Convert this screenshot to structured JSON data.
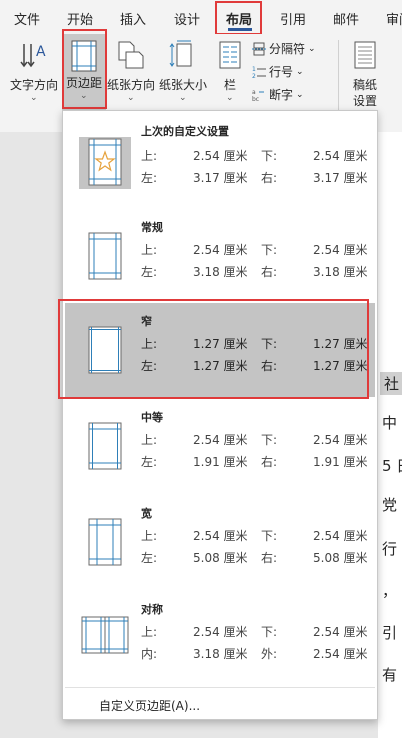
{
  "tabs": [
    {
      "label": "文件"
    },
    {
      "label": "开始"
    },
    {
      "label": "插入"
    },
    {
      "label": "设计"
    },
    {
      "label": "布局"
    },
    {
      "label": "引用"
    },
    {
      "label": "邮件"
    },
    {
      "label": "审阅"
    }
  ],
  "active_tab": "布局",
  "ribbon": {
    "text_direction": "文字方向",
    "margins": "页边距",
    "orientation": "纸张方向",
    "size": "纸张大小",
    "columns": "栏",
    "breaks": "分隔符",
    "line_numbers": "行号",
    "hyphenation": "断字",
    "draft_paper_line1": "稿纸",
    "draft_paper_line2": "设置"
  },
  "margins_menu": {
    "options": [
      {
        "name": "上次的自定义设置",
        "top_label": "上:",
        "top": "2.54 厘米",
        "bottom_label": "下:",
        "bottom": "2.54 厘米",
        "left_label": "左:",
        "left": "3.17 厘米",
        "right_label": "右:",
        "right": "3.17 厘米"
      },
      {
        "name": "常规",
        "top_label": "上:",
        "top": "2.54 厘米",
        "bottom_label": "下:",
        "bottom": "2.54 厘米",
        "left_label": "左:",
        "left": "3.18 厘米",
        "right_label": "右:",
        "right": "3.18 厘米"
      },
      {
        "name": "窄",
        "top_label": "上:",
        "top": "1.27 厘米",
        "bottom_label": "下:",
        "bottom": "1.27 厘米",
        "left_label": "左:",
        "left": "1.27 厘米",
        "right_label": "右:",
        "right": "1.27 厘米"
      },
      {
        "name": "中等",
        "top_label": "上:",
        "top": "2.54 厘米",
        "bottom_label": "下:",
        "bottom": "2.54 厘米",
        "left_label": "左:",
        "left": "1.91 厘米",
        "right_label": "右:",
        "right": "1.91 厘米"
      },
      {
        "name": "宽",
        "top_label": "上:",
        "top": "2.54 厘米",
        "bottom_label": "下:",
        "bottom": "2.54 厘米",
        "left_label": "左:",
        "left": "5.08 厘米",
        "right_label": "右:",
        "right": "5.08 厘米"
      },
      {
        "name": "对称",
        "top_label": "上:",
        "top": "2.54 厘米",
        "bottom_label": "下:",
        "bottom": "2.54 厘米",
        "left_label": "内:",
        "left": "3.18 厘米",
        "right_label": "外:",
        "right": "2.54 厘米"
      }
    ],
    "selected": "窄",
    "custom_label": "自定义页边距(A)..."
  },
  "document": {
    "visible_chars": [
      "社",
      "中",
      "5 日",
      "党",
      "行",
      "，",
      "引",
      "有"
    ]
  },
  "colors": {
    "accent": "#2b579a",
    "highlight": "#e03a3a",
    "hover": "#c4c4c4",
    "margin_line": "#2e7fb8"
  }
}
